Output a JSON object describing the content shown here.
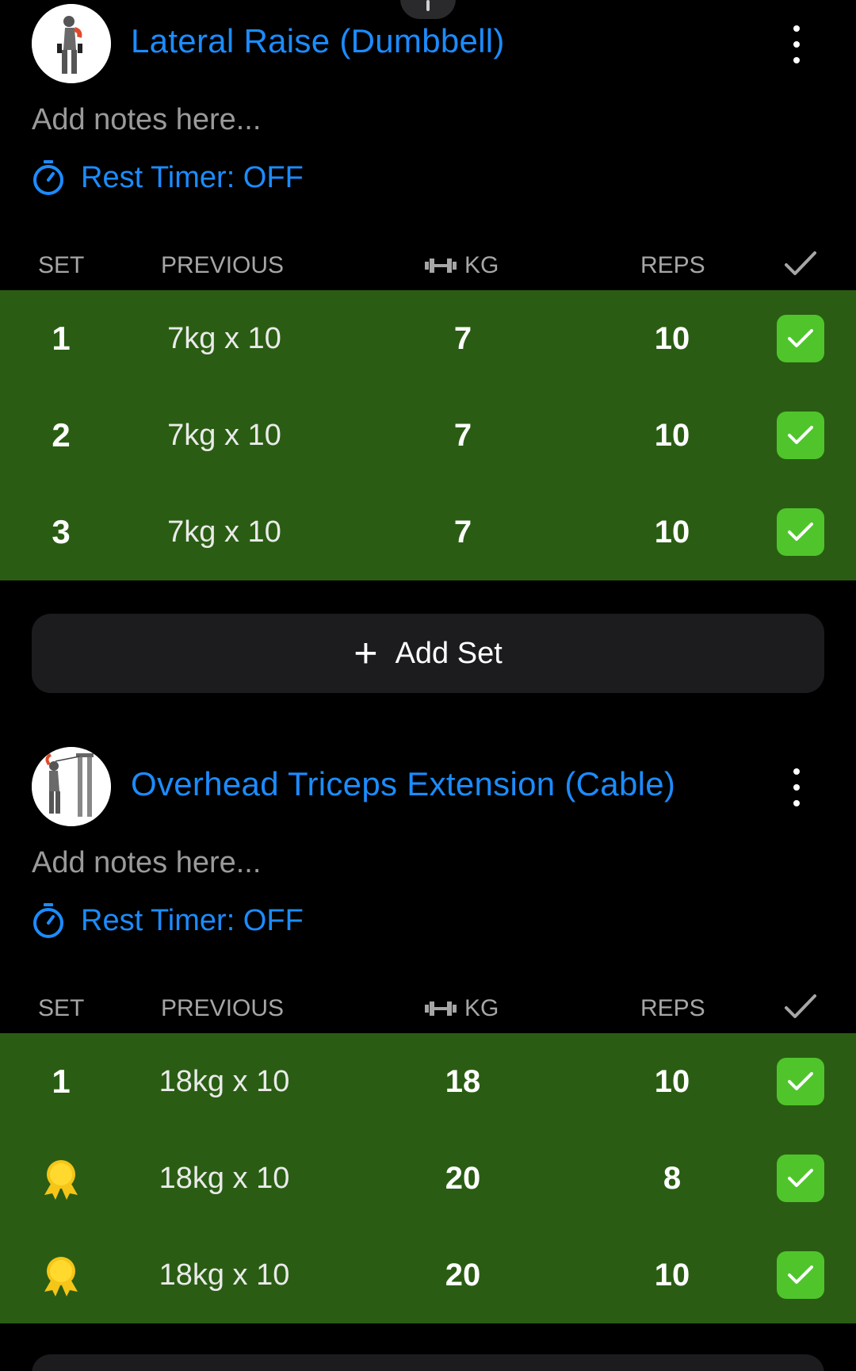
{
  "exercises": [
    {
      "title": "Lateral Raise (Dumbbell)",
      "notes_placeholder": "Add notes here...",
      "rest_timer": "Rest Timer: OFF",
      "columns": {
        "set": "SET",
        "previous": "PREVIOUS",
        "kg": "KG",
        "reps": "REPS"
      },
      "sets": [
        {
          "set": "1",
          "previous": "7kg x 10",
          "kg": "7",
          "reps": "10",
          "completed": true
        },
        {
          "set": "2",
          "previous": "7kg x 10",
          "kg": "7",
          "reps": "10",
          "completed": true
        },
        {
          "set": "3",
          "previous": "7kg x 10",
          "kg": "7",
          "reps": "10",
          "completed": true
        }
      ],
      "add_set": "Add Set"
    },
    {
      "title": "Overhead Triceps Extension (Cable)",
      "notes_placeholder": "Add notes here...",
      "rest_timer": "Rest Timer: OFF",
      "columns": {
        "set": "SET",
        "previous": "PREVIOUS",
        "kg": "KG",
        "reps": "REPS"
      },
      "sets": [
        {
          "set": "1",
          "previous": "18kg x 10",
          "kg": "18",
          "reps": "10",
          "completed": true
        },
        {
          "set": "medal-icon",
          "previous": "18kg x 10",
          "kg": "20",
          "reps": "8",
          "completed": true
        },
        {
          "set": "medal-icon",
          "previous": "18kg x 10",
          "kg": "20",
          "reps": "10",
          "completed": true
        }
      ]
    }
  ],
  "colors": {
    "accent": "#1c8cff",
    "completed_row": "#2a5d13",
    "check": "#4fc52b",
    "medal": "#f5c518"
  }
}
